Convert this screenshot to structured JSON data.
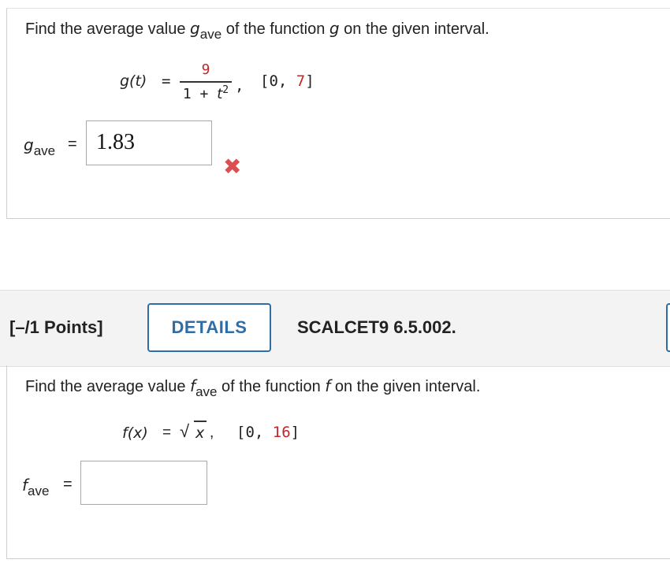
{
  "q1": {
    "prompt_pre": "Find the average value ",
    "prompt_var": "g",
    "prompt_sub": "ave",
    "prompt_mid": " of the function ",
    "prompt_func": "g",
    "prompt_post": " on the given interval.",
    "func_lhs": "g(t)",
    "eq": "=",
    "numerator": "9",
    "denominator_base": "1 + ",
    "denominator_var": "t",
    "denominator_exp": "2",
    "comma": ",",
    "interval_open": "[0, ",
    "interval_end": "7",
    "interval_close": "]",
    "ans_label_var": "g",
    "ans_label_sub": "ave",
    "ans_eq": "=",
    "answer_value": "1.83",
    "incorrect_mark": "✖"
  },
  "q2_header": {
    "points": "[–/1 Points]",
    "details_label": "DETAILS",
    "reference": "SCALCET9 6.5.002."
  },
  "q2": {
    "prompt_pre": "Find the average value ",
    "prompt_var": "f",
    "prompt_sub": "ave",
    "prompt_mid": " of the function ",
    "prompt_func": "f",
    "prompt_post": " on the given interval.",
    "func_lhs": "f(x)",
    "eq": "=",
    "sqrt_symbol": "√",
    "radicand": "x",
    "comma": ",",
    "interval_open": "[0, ",
    "interval_end": "16",
    "interval_close": "]",
    "ans_label_var": "f",
    "ans_label_sub": "ave",
    "ans_eq": "=",
    "answer_value": ""
  },
  "colors": {
    "accent": "#2f6ea5",
    "interval_highlight": "#c0282a",
    "incorrect": "#d9504f"
  }
}
